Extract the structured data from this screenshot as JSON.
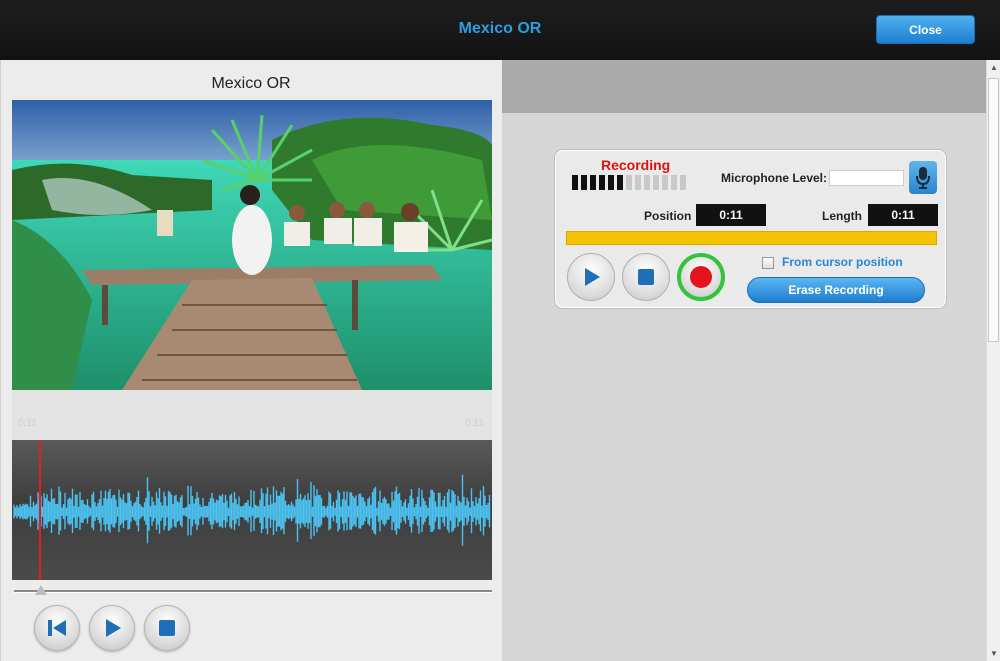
{
  "header": {
    "title": "Mexico OR",
    "close_label": "Close"
  },
  "video": {
    "title": "Mexico OR",
    "time_current": "0:11",
    "time_total": "0:11"
  },
  "recorder": {
    "status_label": "Recording",
    "mic_label": "Microphone Level:",
    "position_label": "Position",
    "position_value": "0:11",
    "length_label": "Length",
    "length_value": "0:11",
    "from_cursor_label": "From cursor position",
    "erase_label": "Erase Recording",
    "progress_fraction": 1.0,
    "meter_segments_active": 6,
    "meter_segments_total": 13,
    "from_cursor_checked": false
  },
  "colors": {
    "accent": "#2d9ee0",
    "recording_red": "#e01010",
    "progress_yellow": "#f4c400",
    "waveform_blue": "#4cc2f0",
    "record_ring_green": "#35c23c"
  }
}
